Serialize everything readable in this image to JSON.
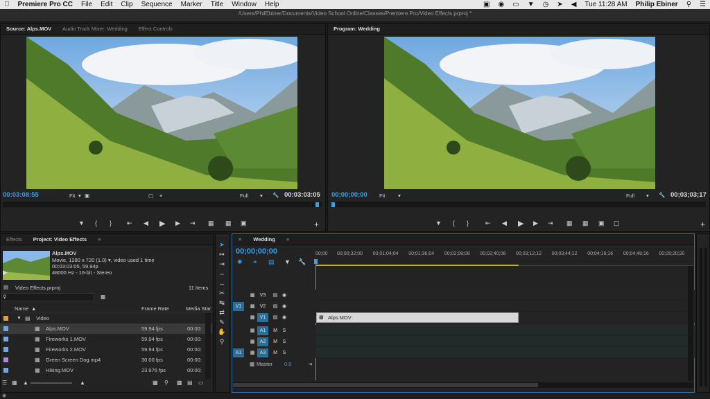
{
  "menubar": {
    "app_name": "Premiere Pro CC",
    "items": [
      "File",
      "Edit",
      "Clip",
      "Sequence",
      "Marker",
      "Title",
      "Window",
      "Help"
    ],
    "clock": "Tue 11:28 AM",
    "user": "Philip Ebiner"
  },
  "path": "/Users/PhilEbiner/Documents/Video School Online/Classes/Premiere Pro/Video Effects.prproj *",
  "source_panel": {
    "tabs": [
      "Source: Alps.MOV",
      "Audio Track Mixer: Wedding",
      "Effect Controls"
    ],
    "timecode_in": "00:03:08:55",
    "fit": "Fit",
    "quality": "Full",
    "timecode_dur": "00:03:03:05"
  },
  "program_panel": {
    "tab": "Program: Wedding",
    "timecode_in": "00;00;00;00",
    "fit": "Fit",
    "quality": "Full",
    "timecode_dur": "00;03;03;17"
  },
  "project_panel": {
    "tabs": [
      "Effects",
      "Project: Video Effects"
    ],
    "clip_name": "Alps.MOV",
    "clip_info1": "Movie, 1280 x 720 (1.0)",
    "clip_info1b": ", video used 1 time",
    "clip_info2": "00:03:03:05, 59.94p",
    "clip_info3": "48000 Hz - 16-bit - Stereo",
    "project_file": "Video Effects.prproj",
    "item_count": "11 Items",
    "col_name": "Name",
    "col_rate": "Frame Rate",
    "col_media": "Media Star",
    "rows": [
      {
        "name": "Video",
        "rate": "",
        "media": "",
        "color": "#e8a030",
        "type": "folder"
      },
      {
        "name": "Alps.MOV",
        "rate": "59.94 fps",
        "media": "00:00:",
        "color": "#6aa8e8",
        "type": "clip"
      },
      {
        "name": "Fireworks 1.MOV",
        "rate": "59.94 fps",
        "media": "00:00:",
        "color": "#6aa8e8",
        "type": "clip"
      },
      {
        "name": "Fireworks 2.MOV",
        "rate": "59.94 fps",
        "media": "00:00:",
        "color": "#6aa8e8",
        "type": "clip"
      },
      {
        "name": "Green Screen Dog.mp4",
        "rate": "30.00 fps",
        "media": "00:00:",
        "color": "#b088e0",
        "type": "clip"
      },
      {
        "name": "Hiking.MOV",
        "rate": "23.976 fps",
        "media": "00:00:",
        "color": "#6aa8e8",
        "type": "clip"
      }
    ]
  },
  "timeline": {
    "tab": "Wedding",
    "timecode": "00;00;00;00",
    "ruler": [
      "00;00",
      "00;00;32;00",
      "00;01;04;04",
      "00;01;36;04",
      "00;02;08;08",
      "00;02;40;08",
      "00;03;12;12",
      "00;03;44;12",
      "00;04;16;16",
      "00;04;48;16",
      "00;05;20;20"
    ],
    "tracks": [
      {
        "src": "",
        "name": "V3",
        "kind": "video"
      },
      {
        "src": "V1",
        "name": "V2",
        "kind": "video"
      },
      {
        "src": "",
        "name": "V1",
        "kind": "video"
      },
      {
        "src": "",
        "name": "A1",
        "kind": "audio"
      },
      {
        "src": "",
        "name": "A2",
        "kind": "audio"
      },
      {
        "src": "A1",
        "name": "A3",
        "kind": "audio"
      }
    ],
    "master_label": "Master",
    "master_value": "0.0",
    "clip_label": "Alps.MOV"
  },
  "colors": {
    "accent": "#3aa0e8",
    "track_on": "#2c6c98",
    "clip": "#d8d8d8"
  }
}
